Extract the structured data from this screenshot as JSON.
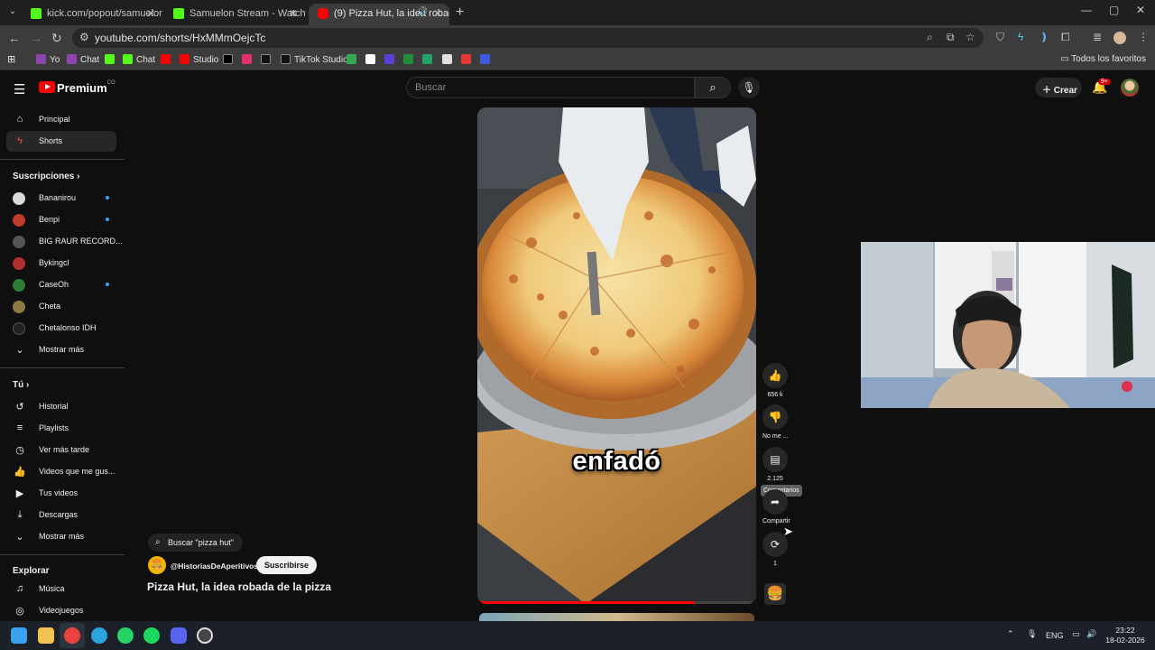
{
  "browser": {
    "tabs": [
      {
        "title": "kick.com/popout/samuelon/ch",
        "active": false
      },
      {
        "title": "Samuelon Stream - Watch Live",
        "active": false
      },
      {
        "title": "(9) Pizza Hut, la idea robada",
        "active": true
      }
    ],
    "new_tab": "+",
    "window_controls": {
      "minimize": "—",
      "maximize": "▢",
      "close": "✕"
    },
    "url": "youtube.com/shorts/HxMMmOejcTc",
    "bookmarks": [
      {
        "label": "Yo",
        "color": "#8e44ad"
      },
      {
        "label": "Chat",
        "color": "#8e44ad"
      },
      {
        "label": "",
        "color": "#53fc18"
      },
      {
        "label": "Chat",
        "color": "#53fc18"
      },
      {
        "label": "",
        "color": "#ff0000"
      },
      {
        "label": "Studio",
        "color": "#ff0000"
      },
      {
        "label": "",
        "color": "#000000"
      },
      {
        "label": "",
        "color": "#e1306c"
      },
      {
        "label": "",
        "color": "#111111"
      },
      {
        "label": "TikTok Studio",
        "color": "#111111"
      },
      {
        "label": "",
        "color": "#34a853"
      },
      {
        "label": "",
        "color": "#ffffff"
      },
      {
        "label": "",
        "color": "#5b3fd6"
      },
      {
        "label": "",
        "color": "#1f8f3a"
      },
      {
        "label": "",
        "color": "#21a366"
      },
      {
        "label": "",
        "color": "#e53935"
      },
      {
        "label": "",
        "color": "#3b5bdb"
      }
    ],
    "all_bookmarks": "Todos los favoritos"
  },
  "youtube": {
    "logo_text": "Premium",
    "logo_suffix": "CO",
    "search_placeholder": "Buscar",
    "create_label": "Crear",
    "notifications_badge": "9+",
    "sidebar": {
      "main": [
        {
          "label": "Principal",
          "icon": "⌂"
        },
        {
          "label": "Shorts",
          "icon": "ϟ",
          "selected": true
        }
      ],
      "subscriptions_header": "Suscripciones",
      "subscriptions": [
        {
          "label": "Bananirou",
          "color": "#d9d9d9",
          "new": true
        },
        {
          "label": "Benpi",
          "color": "#c0392b",
          "new": true
        },
        {
          "label": "BIG RAUR RECORD...",
          "color": "#555555",
          "new": false
        },
        {
          "label": "Bykingcl",
          "color": "#b03030",
          "new": false
        },
        {
          "label": "CaseOh",
          "color": "#2e7d32",
          "new": true
        },
        {
          "label": "Cheta",
          "color": "#8d7b45",
          "new": false
        },
        {
          "label": "Chetalonso IDH",
          "color": "#222222",
          "new": false
        }
      ],
      "show_more_1": "Mostrar más",
      "you_header": "Tú",
      "you": [
        {
          "label": "Historial",
          "icon": "↺"
        },
        {
          "label": "Playlists",
          "icon": "≡"
        },
        {
          "label": "Ver más tarde",
          "icon": "◷"
        },
        {
          "label": "Videos que me gus...",
          "icon": "👍"
        },
        {
          "label": "Tus videos",
          "icon": "▶"
        },
        {
          "label": "Descargas",
          "icon": "⤓"
        }
      ],
      "show_more_2": "Mostrar más",
      "explore_header": "Explorar",
      "explore": [
        {
          "label": "Música",
          "icon": "♫"
        },
        {
          "label": "Videojuegos",
          "icon": "◎"
        }
      ]
    },
    "short": {
      "caption": "enfadó",
      "progress_percent": 78,
      "actions": [
        {
          "name": "like",
          "icon": "👍",
          "count": "656 k"
        },
        {
          "name": "dislike",
          "icon": "👎",
          "count": "No me ..."
        },
        {
          "name": "comments",
          "icon": "▤",
          "count": "2.125"
        },
        {
          "name": "share",
          "icon": "➦",
          "count": "Compartir"
        },
        {
          "name": "remix",
          "icon": "⟳",
          "count": "1"
        }
      ],
      "tooltip": "Comentarios",
      "search_chip": "Buscar \"pizza hut\"",
      "channel": "@HistoriasDeAperitivos",
      "subscribe": "Suscribirse",
      "title": "Pizza Hut, la idea robada de la pizza"
    }
  },
  "taskbar": {
    "apps": [
      {
        "name": "windows",
        "color": "#3aa0f0"
      },
      {
        "name": "explorer",
        "color": "#f2c14e"
      },
      {
        "name": "chrome",
        "color": "#e8453c"
      },
      {
        "name": "telegram",
        "color": "#2aa3de"
      },
      {
        "name": "whatsapp",
        "color": "#25d366"
      },
      {
        "name": "spotify",
        "color": "#1ed760"
      },
      {
        "name": "discord",
        "color": "#5865f2"
      },
      {
        "name": "obs",
        "color": "#444444"
      }
    ],
    "lang": "ENG",
    "time": "23:22",
    "date": "18-02-2026"
  }
}
